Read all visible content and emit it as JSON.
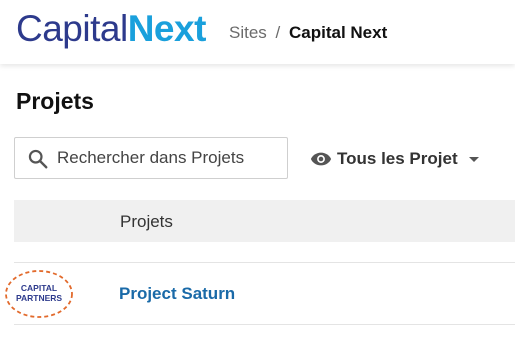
{
  "header": {
    "logo": {
      "part1": "Capital",
      "part2": "Next"
    },
    "breadcrumb": {
      "root": "Sites",
      "separator": "/",
      "current": "Capital Next"
    }
  },
  "main": {
    "title": "Projets",
    "search": {
      "placeholder": "Rechercher dans Projets",
      "value": "",
      "icon": "search-icon"
    },
    "filter": {
      "label": "Tous les Projet",
      "icon": "eye-icon",
      "caret_icon": "caret-down-icon"
    },
    "table": {
      "columns": [
        "Projets"
      ],
      "rows": [
        {
          "logo_text_line1": "CAPITAL",
          "logo_text_line2": "PARTNERS",
          "name": "Project Saturn"
        }
      ]
    }
  },
  "colors": {
    "logo_capital": "#2d3a8c",
    "logo_next": "#1aa0dc",
    "link": "#1a6aa8",
    "logo_ring": "#e26a2c"
  }
}
